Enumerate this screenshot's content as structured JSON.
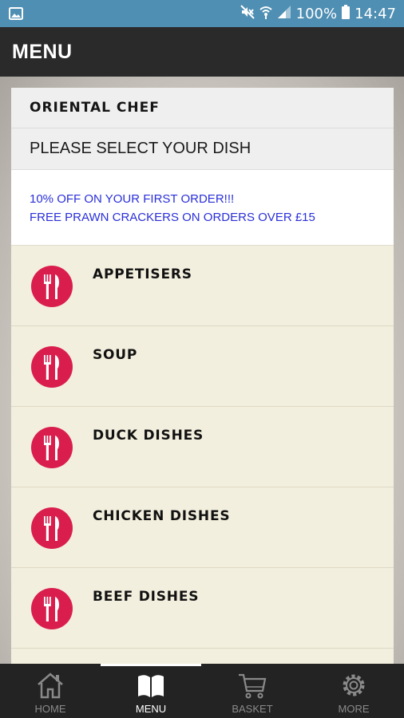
{
  "status_bar": {
    "battery": "100%",
    "time": "14:47",
    "icons": [
      "image-icon",
      "mute-icon",
      "wifi-icon",
      "signal-icon",
      "battery-icon"
    ]
  },
  "app_bar": {
    "title": "MENU"
  },
  "card": {
    "restaurant_name": "ORIENTAL CHEF",
    "select_prompt": "PLEASE SELECT YOUR DISH",
    "promo_lines": [
      "10% OFF ON YOUR FIRST ORDER!!!",
      "FREE PRAWN CRACKERS ON ORDERS OVER £15"
    ]
  },
  "categories": [
    {
      "label": "APPETISERS",
      "icon": "cutlery-icon"
    },
    {
      "label": "SOUP",
      "icon": "cutlery-icon"
    },
    {
      "label": "DUCK DISHES",
      "icon": "cutlery-icon"
    },
    {
      "label": "CHICKEN DISHES",
      "icon": "cutlery-icon"
    },
    {
      "label": "BEEF DISHES",
      "icon": "cutlery-icon"
    }
  ],
  "bottom_nav": [
    {
      "label": "HOME",
      "icon": "home-icon",
      "active": false
    },
    {
      "label": "MENU",
      "icon": "book-icon",
      "active": true
    },
    {
      "label": "BASKET",
      "icon": "cart-icon",
      "active": false
    },
    {
      "label": "MORE",
      "icon": "gear-icon",
      "active": false
    }
  ],
  "colors": {
    "status_bar": "#4f8fb3",
    "app_bar": "#2a2a2a",
    "card_background": "#f3efde",
    "promo_text": "#2a2fd8",
    "badge": "#d91e4e",
    "bottom_nav": "#232323"
  }
}
